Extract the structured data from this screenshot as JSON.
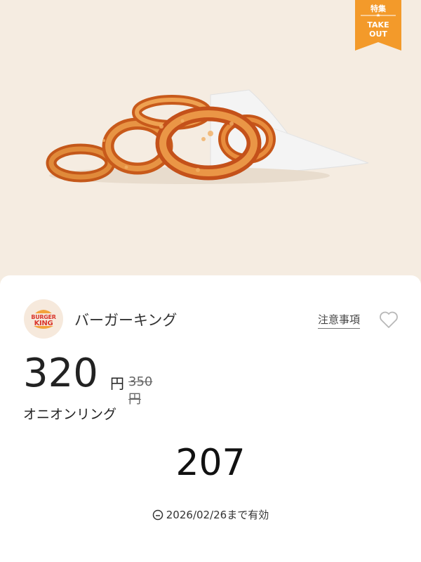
{
  "hero": {
    "image": "onion-rings-photo",
    "badge": {
      "label_top": "特集",
      "star": "★",
      "line1": "TAKE",
      "line2": "OUT",
      "color": "#f39a2a"
    }
  },
  "card": {
    "logo": {
      "line1": "BURGER",
      "line2": "KING"
    },
    "brand": "バーガーキング",
    "notes_link": "注意事項",
    "favorite_icon": "heart-icon",
    "price": "320",
    "price_unit": "円",
    "original_price": "350円",
    "product_name": "オニオンリング",
    "coupon_code": "207",
    "validity_icon": "clock-icon",
    "validity": "2026/02/26まで有効"
  }
}
